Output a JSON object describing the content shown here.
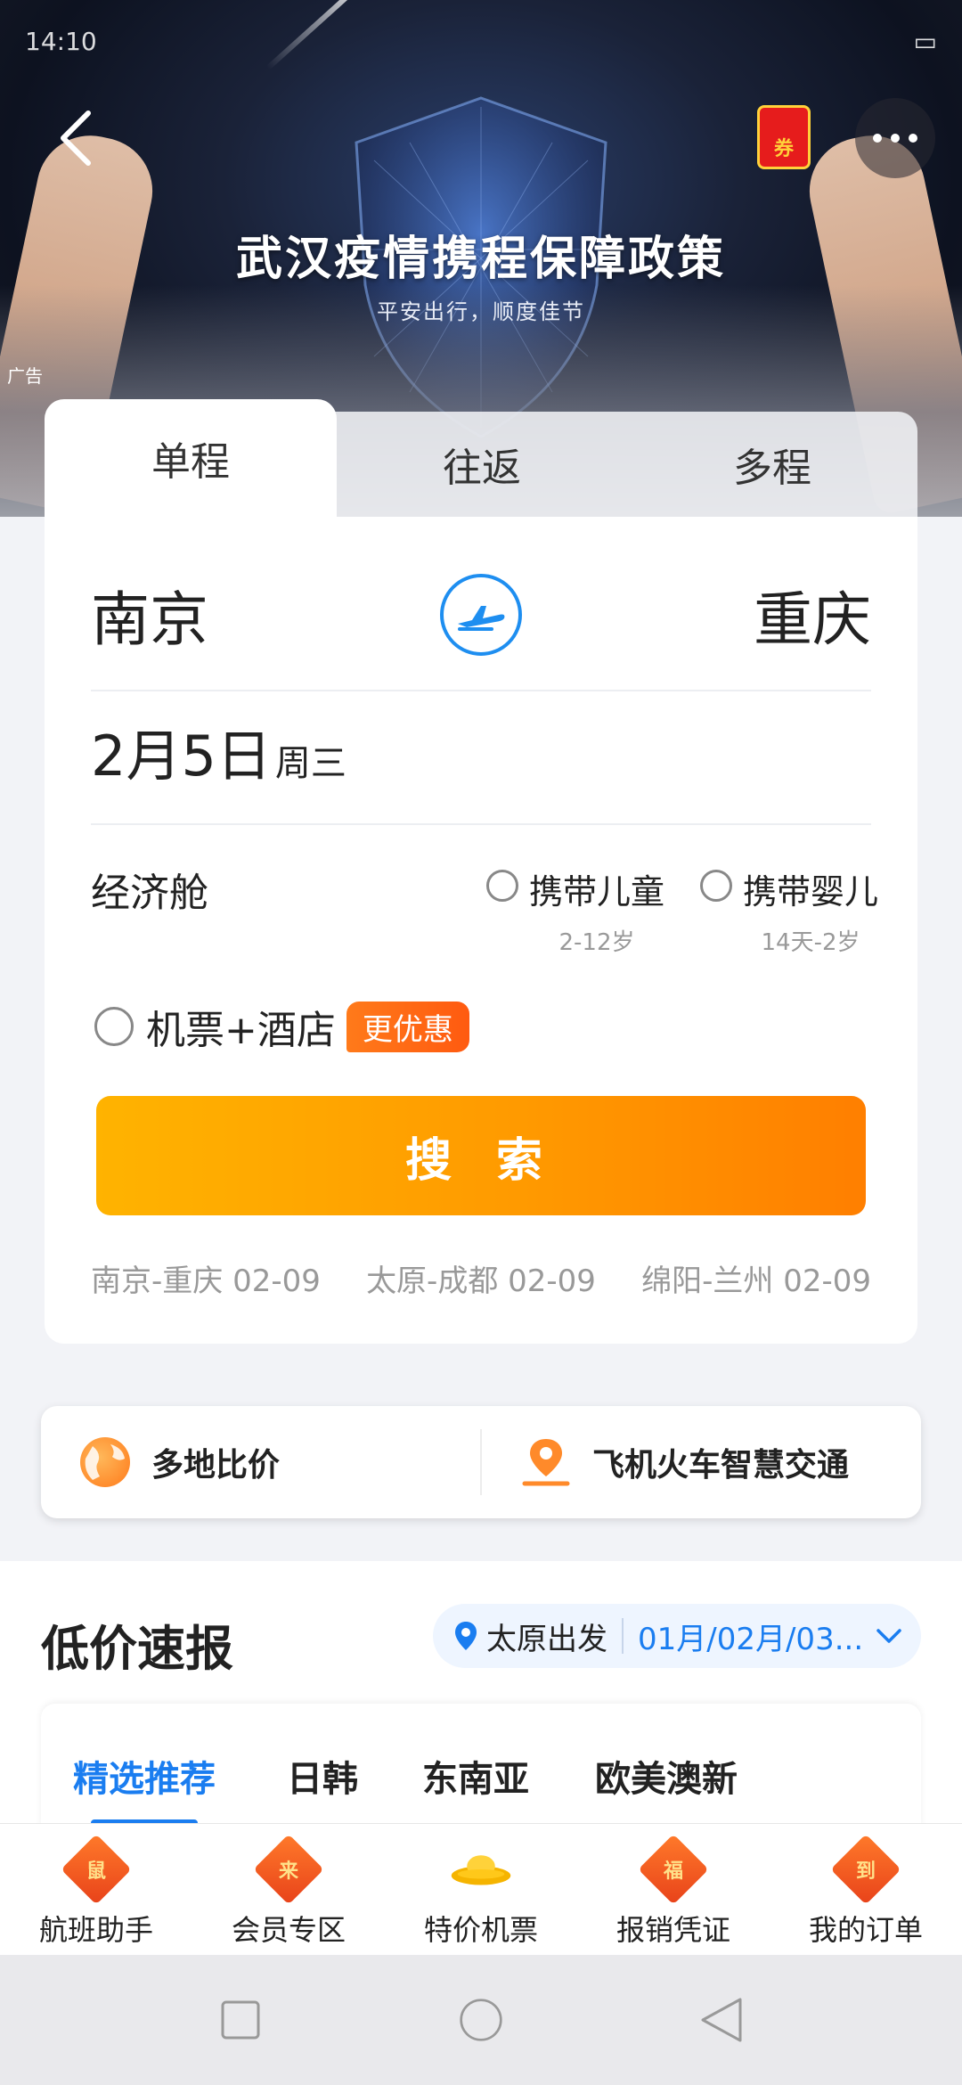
{
  "status_bar": {
    "time": "14:10",
    "signal": ".ıl",
    "battery": ""
  },
  "banner": {
    "title": "武汉疫情携程保障政策",
    "subtitle": "平安出行，顺度佳节",
    "ad_label": "广告",
    "coupon_label": "券"
  },
  "trip_tabs": [
    {
      "label": "单程",
      "active": true
    },
    {
      "label": "往返",
      "active": false
    },
    {
      "label": "多程",
      "active": false
    }
  ],
  "search_form": {
    "from_city": "南京",
    "to_city": "重庆",
    "date": "2月5日",
    "weekday": "周三",
    "cabin": "经济舱",
    "child_option": {
      "label": "携带儿童",
      "hint": "2-12岁"
    },
    "infant_option": {
      "label": "携带婴儿",
      "hint": "14天-2岁"
    },
    "hotel_option": {
      "label": "机票+酒店",
      "badge": "更优惠"
    },
    "search_button": "搜 索",
    "history": [
      "南京-重庆 02-09",
      "太原-成都 02-09",
      "绵阳-兰州 02-09"
    ]
  },
  "features": [
    {
      "label": "多地比价",
      "icon": "globe-icon"
    },
    {
      "label": "飞机火车智慧交通",
      "icon": "location-pin-icon"
    }
  ],
  "low_price": {
    "title": "低价速报",
    "origin": "太原出发",
    "dates": "01月/02月/03...",
    "tabs": [
      "精选推荐",
      "日韩",
      "东南亚",
      "欧美澳新"
    ],
    "active_tab": 0
  },
  "bottom_nav": [
    {
      "label": "航班助手",
      "icon_char": "鼠"
    },
    {
      "label": "会员专区",
      "icon_char": "来"
    },
    {
      "label": "特价机票",
      "icon_char": ""
    },
    {
      "label": "报销凭证",
      "icon_char": "福"
    },
    {
      "label": "我的订单",
      "icon_char": "到"
    }
  ],
  "colors": {
    "accent_blue": "#1a7df0",
    "search_orange": "#ff9a00",
    "badge_orange": "#ff6a14"
  }
}
